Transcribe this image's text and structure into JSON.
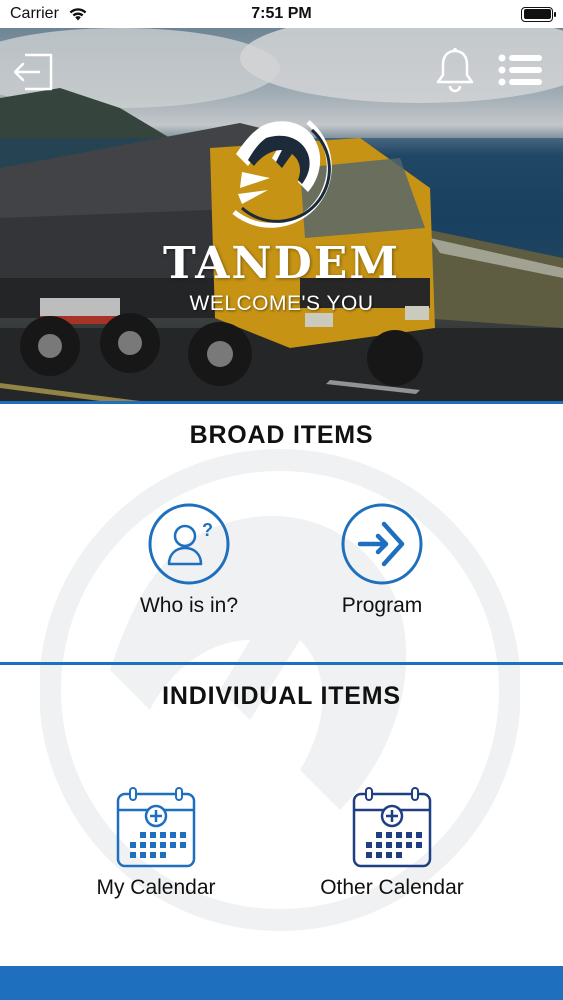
{
  "status_bar": {
    "carrier": "Carrier",
    "time": "7:51 PM"
  },
  "hero": {
    "brand_name": "TANDEM",
    "tagline": "WELCOME'S YOU",
    "icons": {
      "exit": "exit-icon",
      "bell": "bell-icon",
      "menu": "menu-icon",
      "logo": "horse-logo-icon"
    }
  },
  "broad_section": {
    "title": "BROAD ITEMS",
    "items": [
      {
        "label": "Who is in?",
        "icon": "user-question-icon"
      },
      {
        "label": "Program",
        "icon": "arrow-enter-icon"
      }
    ]
  },
  "individual_section": {
    "title": "INDIVIDUAL ITEMS",
    "items": [
      {
        "label": "My Calendar",
        "icon": "calendar-plus-icon"
      },
      {
        "label": "Other Calendar",
        "icon": "calendar-plus-icon"
      }
    ]
  },
  "colors": {
    "accent": "#1f6fbf",
    "icon_blue": "#1f6fbf",
    "text": "#111111"
  }
}
